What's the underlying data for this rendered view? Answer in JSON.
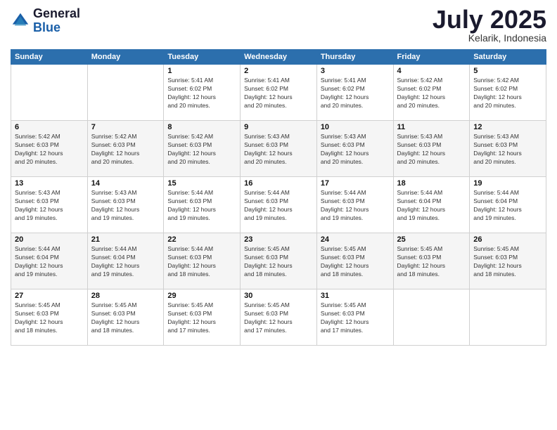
{
  "logo": {
    "line1": "General",
    "line2": "Blue"
  },
  "header": {
    "month": "July 2025",
    "location": "Kelarik, Indonesia"
  },
  "weekdays": [
    "Sunday",
    "Monday",
    "Tuesday",
    "Wednesday",
    "Thursday",
    "Friday",
    "Saturday"
  ],
  "weeks": [
    [
      {
        "day": "",
        "info": ""
      },
      {
        "day": "",
        "info": ""
      },
      {
        "day": "1",
        "info": "Sunrise: 5:41 AM\nSunset: 6:02 PM\nDaylight: 12 hours\nand 20 minutes."
      },
      {
        "day": "2",
        "info": "Sunrise: 5:41 AM\nSunset: 6:02 PM\nDaylight: 12 hours\nand 20 minutes."
      },
      {
        "day": "3",
        "info": "Sunrise: 5:41 AM\nSunset: 6:02 PM\nDaylight: 12 hours\nand 20 minutes."
      },
      {
        "day": "4",
        "info": "Sunrise: 5:42 AM\nSunset: 6:02 PM\nDaylight: 12 hours\nand 20 minutes."
      },
      {
        "day": "5",
        "info": "Sunrise: 5:42 AM\nSunset: 6:02 PM\nDaylight: 12 hours\nand 20 minutes."
      }
    ],
    [
      {
        "day": "6",
        "info": "Sunrise: 5:42 AM\nSunset: 6:03 PM\nDaylight: 12 hours\nand 20 minutes."
      },
      {
        "day": "7",
        "info": "Sunrise: 5:42 AM\nSunset: 6:03 PM\nDaylight: 12 hours\nand 20 minutes."
      },
      {
        "day": "8",
        "info": "Sunrise: 5:42 AM\nSunset: 6:03 PM\nDaylight: 12 hours\nand 20 minutes."
      },
      {
        "day": "9",
        "info": "Sunrise: 5:43 AM\nSunset: 6:03 PM\nDaylight: 12 hours\nand 20 minutes."
      },
      {
        "day": "10",
        "info": "Sunrise: 5:43 AM\nSunset: 6:03 PM\nDaylight: 12 hours\nand 20 minutes."
      },
      {
        "day": "11",
        "info": "Sunrise: 5:43 AM\nSunset: 6:03 PM\nDaylight: 12 hours\nand 20 minutes."
      },
      {
        "day": "12",
        "info": "Sunrise: 5:43 AM\nSunset: 6:03 PM\nDaylight: 12 hours\nand 20 minutes."
      }
    ],
    [
      {
        "day": "13",
        "info": "Sunrise: 5:43 AM\nSunset: 6:03 PM\nDaylight: 12 hours\nand 19 minutes."
      },
      {
        "day": "14",
        "info": "Sunrise: 5:43 AM\nSunset: 6:03 PM\nDaylight: 12 hours\nand 19 minutes."
      },
      {
        "day": "15",
        "info": "Sunrise: 5:44 AM\nSunset: 6:03 PM\nDaylight: 12 hours\nand 19 minutes."
      },
      {
        "day": "16",
        "info": "Sunrise: 5:44 AM\nSunset: 6:03 PM\nDaylight: 12 hours\nand 19 minutes."
      },
      {
        "day": "17",
        "info": "Sunrise: 5:44 AM\nSunset: 6:03 PM\nDaylight: 12 hours\nand 19 minutes."
      },
      {
        "day": "18",
        "info": "Sunrise: 5:44 AM\nSunset: 6:04 PM\nDaylight: 12 hours\nand 19 minutes."
      },
      {
        "day": "19",
        "info": "Sunrise: 5:44 AM\nSunset: 6:04 PM\nDaylight: 12 hours\nand 19 minutes."
      }
    ],
    [
      {
        "day": "20",
        "info": "Sunrise: 5:44 AM\nSunset: 6:04 PM\nDaylight: 12 hours\nand 19 minutes."
      },
      {
        "day": "21",
        "info": "Sunrise: 5:44 AM\nSunset: 6:04 PM\nDaylight: 12 hours\nand 19 minutes."
      },
      {
        "day": "22",
        "info": "Sunrise: 5:44 AM\nSunset: 6:03 PM\nDaylight: 12 hours\nand 18 minutes."
      },
      {
        "day": "23",
        "info": "Sunrise: 5:45 AM\nSunset: 6:03 PM\nDaylight: 12 hours\nand 18 minutes."
      },
      {
        "day": "24",
        "info": "Sunrise: 5:45 AM\nSunset: 6:03 PM\nDaylight: 12 hours\nand 18 minutes."
      },
      {
        "day": "25",
        "info": "Sunrise: 5:45 AM\nSunset: 6:03 PM\nDaylight: 12 hours\nand 18 minutes."
      },
      {
        "day": "26",
        "info": "Sunrise: 5:45 AM\nSunset: 6:03 PM\nDaylight: 12 hours\nand 18 minutes."
      }
    ],
    [
      {
        "day": "27",
        "info": "Sunrise: 5:45 AM\nSunset: 6:03 PM\nDaylight: 12 hours\nand 18 minutes."
      },
      {
        "day": "28",
        "info": "Sunrise: 5:45 AM\nSunset: 6:03 PM\nDaylight: 12 hours\nand 18 minutes."
      },
      {
        "day": "29",
        "info": "Sunrise: 5:45 AM\nSunset: 6:03 PM\nDaylight: 12 hours\nand 17 minutes."
      },
      {
        "day": "30",
        "info": "Sunrise: 5:45 AM\nSunset: 6:03 PM\nDaylight: 12 hours\nand 17 minutes."
      },
      {
        "day": "31",
        "info": "Sunrise: 5:45 AM\nSunset: 6:03 PM\nDaylight: 12 hours\nand 17 minutes."
      },
      {
        "day": "",
        "info": ""
      },
      {
        "day": "",
        "info": ""
      }
    ]
  ]
}
